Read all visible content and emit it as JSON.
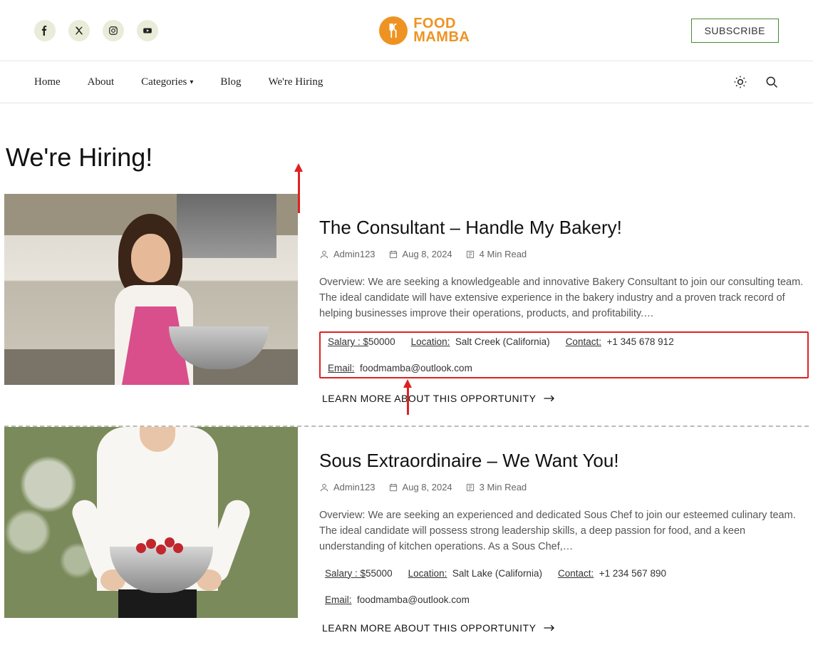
{
  "brand": {
    "line1": "FOOD",
    "line2": "MAMBA"
  },
  "subscribe_label": "SUBSCRIBE",
  "nav": {
    "items": [
      {
        "label": "Home"
      },
      {
        "label": "About"
      },
      {
        "label": "Categories"
      },
      {
        "label": "Blog"
      },
      {
        "label": "We're Hiring"
      }
    ]
  },
  "page_title": "We're Hiring!",
  "posts": [
    {
      "title": "The Consultant – Handle My Bakery!",
      "author": "Admin123",
      "date": "Aug 8, 2024",
      "read": "4 Min Read",
      "excerpt": "Overview: We are seeking a knowledgeable and innovative Bakery Consultant to join our consulting team. The ideal candidate will have extensive experience in the bakery industry and a proven track record of helping businesses improve their operations, products, and profitability.…",
      "salary_label": "Salary : $",
      "salary_value": "50000",
      "location_label": "Location:",
      "location_value": "Salt Creek (California)",
      "contact_label": "Contact:",
      "contact_value": "+1 345 678 912",
      "email_label": "Email:",
      "email_value": "foodmamba@outlook.com",
      "cta": "LEARN MORE ABOUT THIS OPPORTUNITY",
      "highlighted": true
    },
    {
      "title": "Sous Extraordinaire – We Want You!",
      "author": "Admin123",
      "date": "Aug 8, 2024",
      "read": "3 Min Read",
      "excerpt": "Overview: We are seeking an experienced and dedicated Sous Chef to join our esteemed culinary team. The ideal candidate will possess strong leadership skills, a deep passion for food, and a keen understanding of kitchen operations. As a Sous Chef,…",
      "salary_label": "Salary : $",
      "salary_value": "55000",
      "location_label": "Location:",
      "location_value": "Salt Lake (California)",
      "contact_label": "Contact:",
      "contact_value": "+1 234 567 890",
      "email_label": "Email:",
      "email_value": "foodmamba@outlook.com",
      "cta": "LEARN MORE ABOUT THIS OPPORTUNITY",
      "highlighted": false
    }
  ]
}
